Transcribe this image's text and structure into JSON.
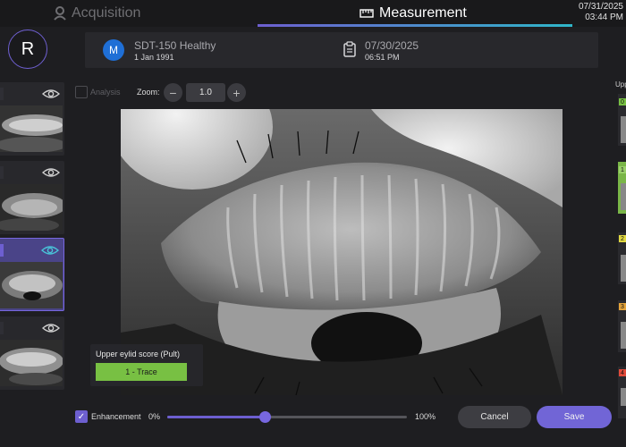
{
  "tabs": {
    "acquisition": "Acquisition",
    "measurement": "Measurement"
  },
  "clock": {
    "date": "07/31/2025",
    "time": "03:44 PM"
  },
  "user": {
    "initial": "R"
  },
  "patient": {
    "initial": "M",
    "name": "SDT-150 Healthy",
    "dob": "1 Jan 1991",
    "exam_date": "07/30/2025",
    "exam_time": "06:51 PM"
  },
  "toolbar": {
    "analysis_label": "Analysis",
    "zoom_label": "Zoom:",
    "zoom_minus": "−",
    "zoom_value": "1.0",
    "zoom_plus": "+"
  },
  "score": {
    "title": "Upper eylid score (Pult)",
    "value": "1 - Trace"
  },
  "bottom": {
    "enhancement_label": "Enhancement",
    "min_label": "0%",
    "max_label": "100%",
    "enhancement_value": 0.41,
    "cancel_label": "Cancel",
    "save_label": "Save"
  },
  "right_panel": {
    "label": "Upp",
    "tags": [
      "0",
      "1",
      "2",
      "3",
      "4"
    ]
  },
  "colors": {
    "accent": "#6d5fd0",
    "score_green": "#78c043",
    "patient_avatar": "#1f6fd6"
  }
}
